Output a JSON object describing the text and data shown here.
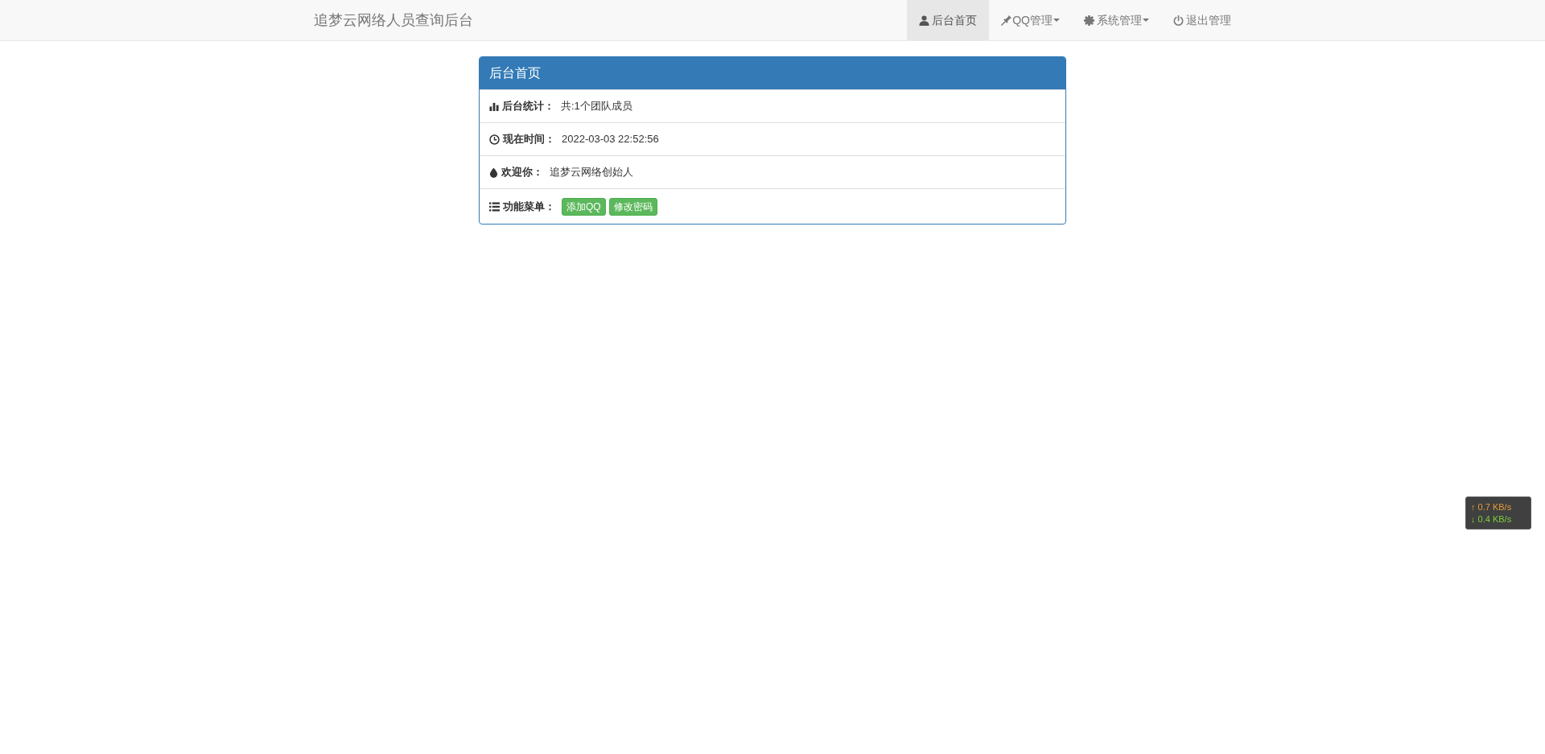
{
  "navbar": {
    "brand": "追梦云网络人员查询后台",
    "items": [
      {
        "label": "后台首页",
        "selected": true,
        "dropdown": false
      },
      {
        "label": "QQ管理",
        "selected": false,
        "dropdown": true
      },
      {
        "label": "系统管理",
        "selected": false,
        "dropdown": true
      },
      {
        "label": "退出管理",
        "selected": false,
        "dropdown": false
      }
    ]
  },
  "panel": {
    "title": "后台首页",
    "rows": [
      {
        "kind": "text",
        "label": "后台统计：",
        "value": "共:1个团队成员"
      },
      {
        "kind": "text",
        "label": "现在时间：",
        "value": "2022-03-03 22:52:56"
      },
      {
        "kind": "text",
        "label": "欢迎你：",
        "value": "追梦云网络创始人"
      },
      {
        "kind": "buttons",
        "label": "功能菜单：",
        "buttons": [
          "添加QQ",
          "修改密码"
        ]
      }
    ]
  },
  "net_speed": {
    "upload": "↑ 0.7 KB/s",
    "download": "↓ 0.4 KB/s"
  }
}
